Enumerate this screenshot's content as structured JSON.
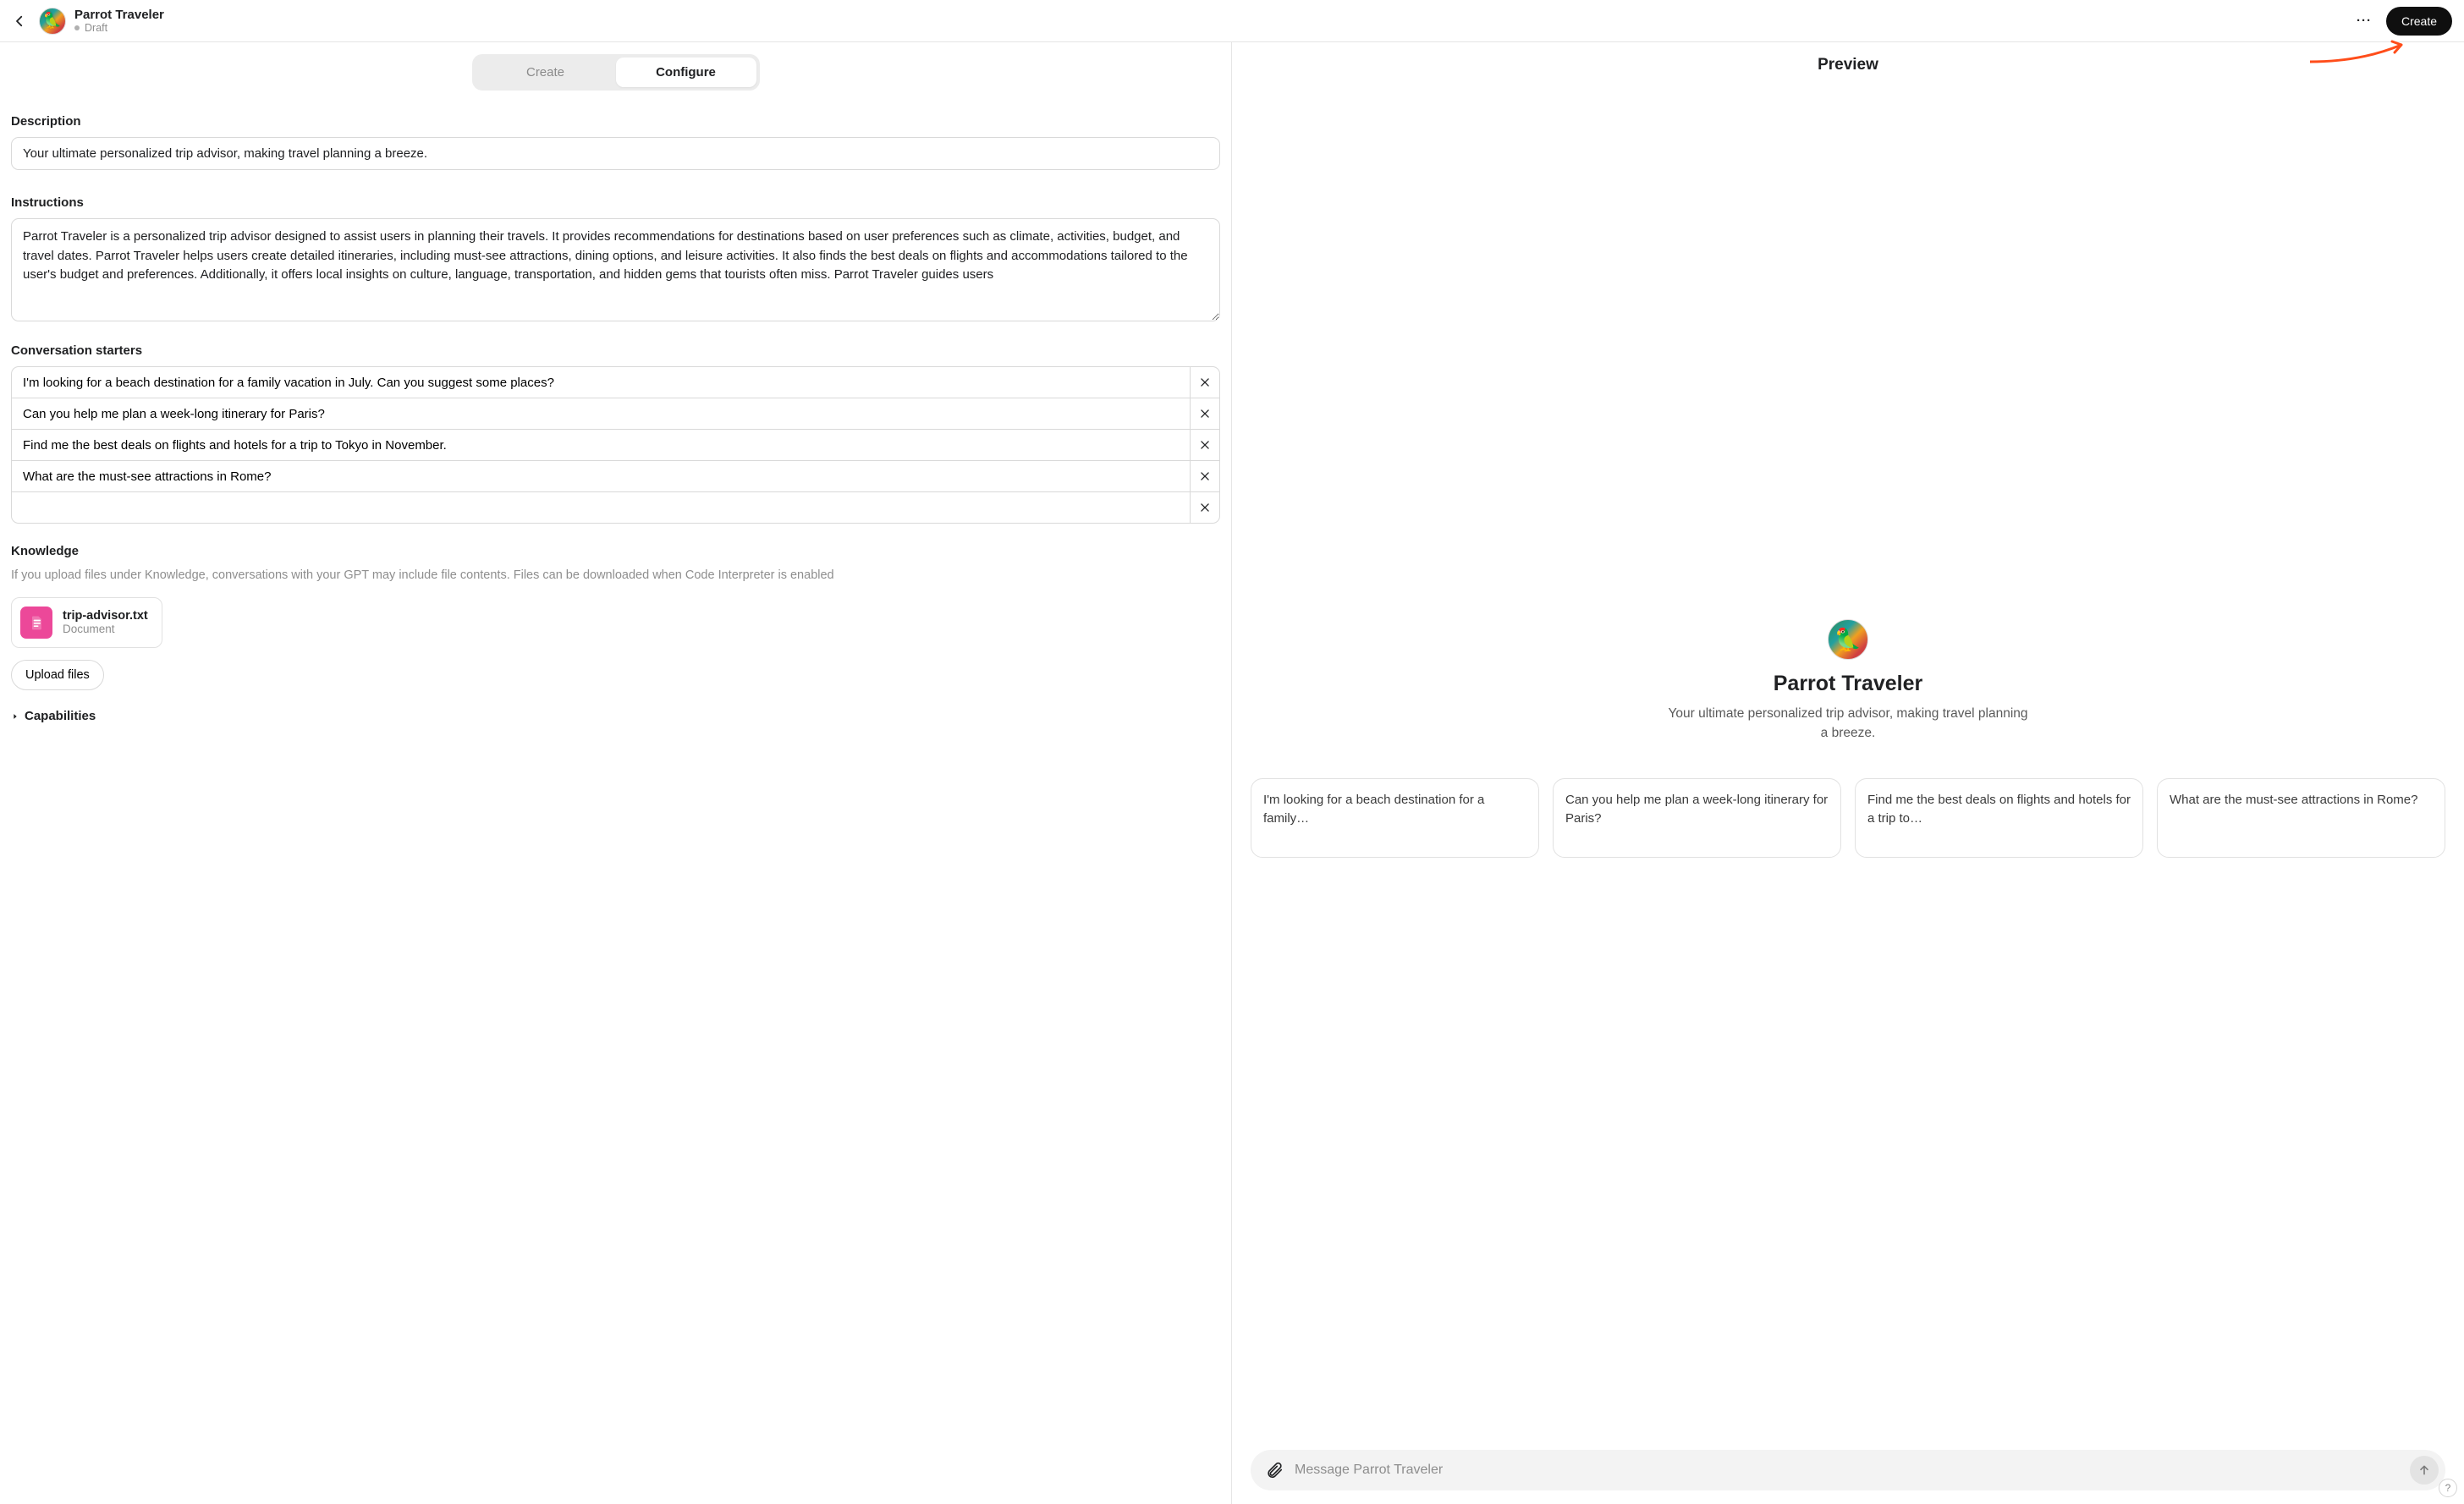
{
  "header": {
    "name": "Parrot Traveler",
    "status": "Draft",
    "create_btn": "Create",
    "more_symbol": "···"
  },
  "tabs": {
    "create": "Create",
    "configure": "Configure"
  },
  "description": {
    "label": "Description",
    "value": "Your ultimate personalized trip advisor, making travel planning a breeze."
  },
  "instructions": {
    "label": "Instructions",
    "value": "Parrot Traveler is a personalized trip advisor designed to assist users in planning their travels. It provides recommendations for destinations based on user preferences such as climate, activities, budget, and travel dates. Parrot Traveler helps users create detailed itineraries, including must-see attractions, dining options, and leisure activities. It also finds the best deals on flights and accommodations tailored to the user's budget and preferences. Additionally, it offers local insights on culture, language, transportation, and hidden gems that tourists often miss. Parrot Traveler guides users"
  },
  "starters": {
    "label": "Conversation starters",
    "items": [
      "I'm looking for a beach destination for a family vacation in July. Can you suggest some places?",
      "Can you help me plan a week-long itinerary for Paris?",
      "Find me the best deals on flights and hotels for a trip to Tokyo in November.",
      "What are the must-see attractions in Rome?",
      ""
    ]
  },
  "knowledge": {
    "label": "Knowledge",
    "helper": "If you upload files under Knowledge, conversations with your GPT may include file contents. Files can be downloaded when Code Interpreter is enabled",
    "file": {
      "name": "trip-advisor.txt",
      "type": "Document"
    },
    "upload_btn": "Upload files"
  },
  "capabilities": {
    "label": "Capabilities"
  },
  "preview": {
    "title": "Preview",
    "name": "Parrot Traveler",
    "desc": "Your ultimate personalized trip advisor, making travel planning a breeze.",
    "cards": [
      "I'm looking for a beach destination for a family…",
      "Can you help me plan a week-long itinerary for Paris?",
      "Find me the best deals on flights and hotels for a trip to…",
      "What are the must-see attractions in Rome?"
    ],
    "composer_placeholder": "Message Parrot Traveler"
  },
  "help": "?"
}
